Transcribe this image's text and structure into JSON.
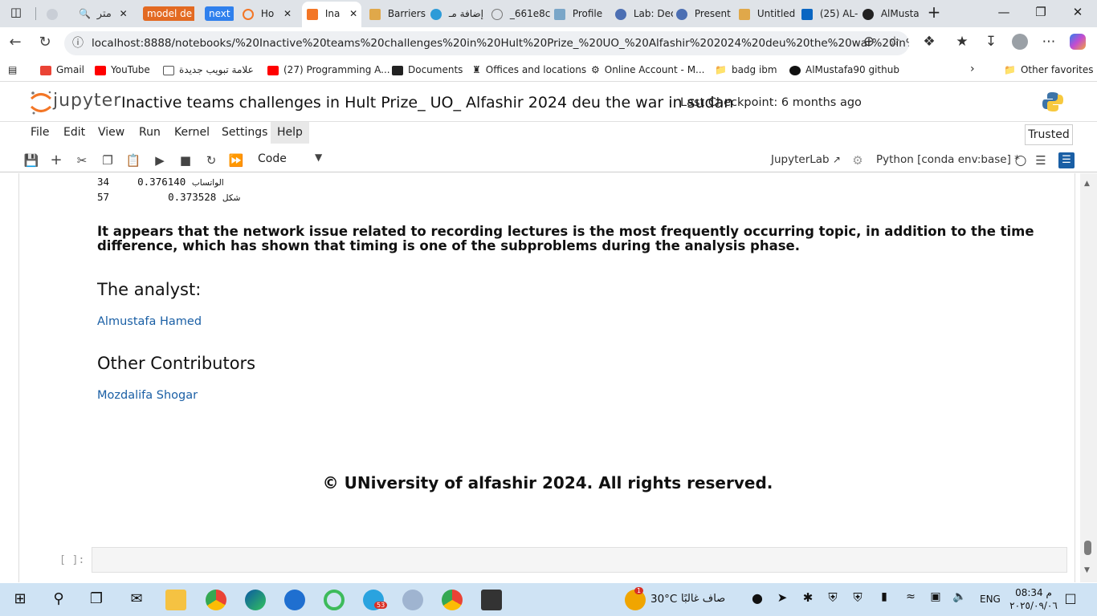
{
  "browser": {
    "tabs": [
      {
        "label": "متر",
        "color": "#888"
      },
      {
        "label": "model de",
        "color": "#e36a22"
      },
      {
        "label": "next",
        "color": "#2f80ed"
      },
      {
        "label": "Ho",
        "color": "#f37626"
      },
      {
        "label": "Ina",
        "color": "#f37626"
      },
      {
        "label": "Barriers",
        "color": "#e0a84a"
      },
      {
        "label": "إضافة مـ",
        "color": "#2d9bd8"
      },
      {
        "label": "_661e8c",
        "color": "#777"
      },
      {
        "label": "Profile",
        "color": "#7aa6c8"
      },
      {
        "label": "Lab: Dec",
        "color": "#4c6fb3"
      },
      {
        "label": "Present",
        "color": "#4c6fb3"
      },
      {
        "label": "Untitled",
        "color": "#e0a84a"
      },
      {
        "label": "(25) AL-",
        "color": "#0a66c2"
      },
      {
        "label": "AlMusta",
        "color": "#222"
      }
    ],
    "url": "localhost:8888/notebooks/%20Inactive%20teams%20challenges%20in%20Hult%20Prize_%20UO_%20Alfashir%202024%20deu%20the%20war%20in%20...",
    "bookmarks": [
      {
        "label": "Gmail",
        "color": "#ea4335"
      },
      {
        "label": "YouTube",
        "color": "#ff0000"
      },
      {
        "label": "علامة تبويب جديدة",
        "color": "#555"
      },
      {
        "label": "(27) Programming A...",
        "color": "#ff0000"
      },
      {
        "label": "Documents",
        "color": "#222"
      },
      {
        "label": "Offices and locations",
        "color": "#555"
      },
      {
        "label": "Online Account - M...",
        "color": "#333"
      },
      {
        "label": "badg  ibm",
        "color": "#fff"
      },
      {
        "label": "AlMustafa90 github",
        "color": "#111"
      }
    ],
    "other_favorites": "Other favorites"
  },
  "jupyter": {
    "logo_text": "jupyter",
    "title": "Inactive teams challenges in Hult Prize_ UO_ Alfashir 2024 deu the war in sudan",
    "checkpoint": "Last Checkpoint: 6 months ago",
    "menu": [
      "File",
      "Edit",
      "View",
      "Run",
      "Kernel",
      "Settings",
      "Help"
    ],
    "trusted": "Trusted",
    "toolbar": {
      "cell_type": "Code",
      "jupyterlab": "JupyterLab",
      "kernel": "Python [conda env:base] *"
    }
  },
  "notebook": {
    "output_rows": [
      {
        "index": "34",
        "value": "0.376140",
        "word": "الواتساب"
      },
      {
        "index": "57",
        "value": "0.373528",
        "word": "شكل"
      }
    ],
    "paragraph": "It appears that the network issue related to recording lectures is the most frequently occurring topic, in addition to the time difference, which has shown that timing is one of the subproblems during the analysis phase.",
    "analyst_heading": "The analyst:",
    "analyst_name": "Almustafa Hamed",
    "contributors_heading": "Other Contributors",
    "contributor_name": "Mozdalifa Shogar",
    "copyright": "© UNiversity of alfashir 2024. All rights reserved.",
    "prompt": "[ ]:"
  },
  "taskbar": {
    "weather_temp": "30°C",
    "weather_desc": "صاف غالبًا",
    "lang": "ENG",
    "time": "08:34 م",
    "date": "٢٠٢٥/٠٩/٠٦",
    "telegram_badge": "53",
    "weather_badge": "1"
  }
}
